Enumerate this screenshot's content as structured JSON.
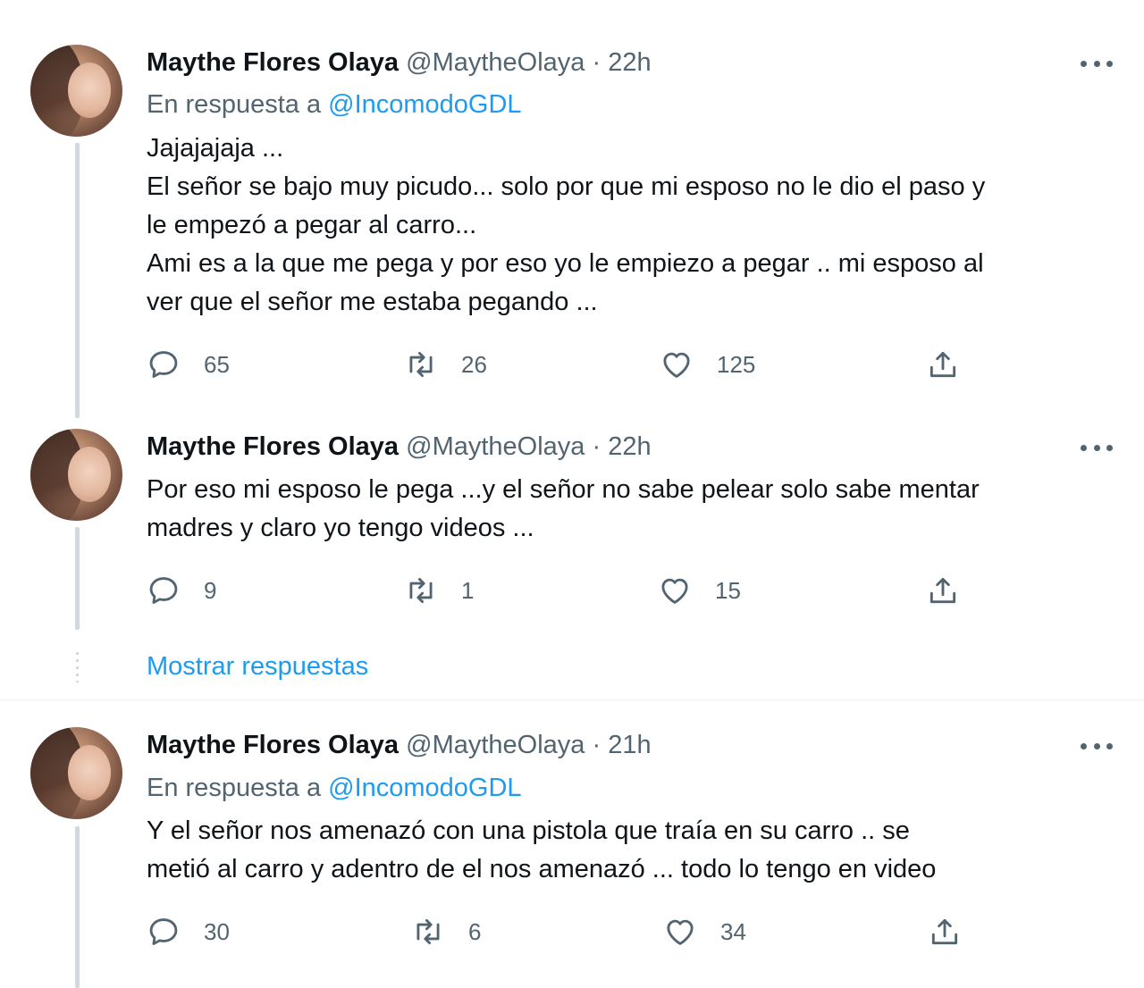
{
  "tweets": [
    {
      "name": "Maythe Flores Olaya",
      "handle": "@MaytheOlaya",
      "dot": "·",
      "time": "22h",
      "reply_prefix": "En respuesta a ",
      "reply_mention": "@IncomodoGDL",
      "lines": [
        "Jajajajaja ...",
        "El  señor  se  bajo  muy picudo... solo  por que mi  esposo no le dio el paso y",
        "le  empezó  a pegar al  carro...",
        "Ami es  a la que me pega   y por eso yo le empiezo a  pegar .. mi esposo al",
        "ver   que el señor me estaba pegando ..."
      ],
      "replies": "65",
      "retweets": "26",
      "likes": "125"
    },
    {
      "name": "Maythe Flores Olaya",
      "handle": "@MaytheOlaya",
      "dot": "·",
      "time": "22h",
      "lines": [
        "Por  eso mi  esposo  le  pega ...y el señor   no  sabe pelear solo sabe mentar",
        "madres y  claro  yo  tengo  videos ..."
      ],
      "replies": "9",
      "retweets": "1",
      "likes": "15"
    },
    {
      "name": "Maythe Flores Olaya",
      "handle": "@MaytheOlaya",
      "dot": "·",
      "time": "21h",
      "reply_prefix": "En respuesta a ",
      "reply_mention": "@IncomodoGDL",
      "lines": [
        "Y el  señor  nos  amenazó  con  una pistola  que  traía  en  su carro .. se",
        "metió  al  carro   y adentro  de  el nos  amenazó  ... todo lo tengo  en  video"
      ],
      "replies": "30",
      "retweets": "6",
      "likes": "34"
    }
  ],
  "show_replies_label": "Mostrar respuestas",
  "icons": {
    "more": "more-horizontal-icon",
    "reply": "reply-bubble-icon",
    "retweet": "retweet-icon",
    "like": "heart-icon",
    "share": "share-upload-icon"
  },
  "colors": {
    "text": "#0f1419",
    "secondary": "#536471",
    "accent": "#1d9bf0",
    "thread_line": "#cfd9de"
  }
}
